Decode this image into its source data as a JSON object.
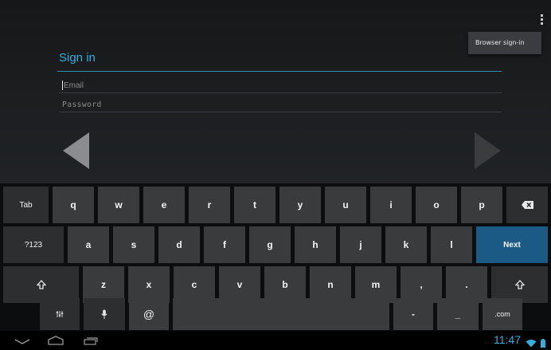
{
  "menu": {
    "overflow_icon": "overflow-menu-icon",
    "popup_item": "Browser sign-in"
  },
  "signin": {
    "title": "Sign in",
    "email_placeholder": "Email",
    "password_placeholder": "Password"
  },
  "pager": {
    "prev_icon": "arrow-left-icon",
    "next_icon": "arrow-right-icon"
  },
  "keyboard": {
    "row1": [
      "q",
      "w",
      "e",
      "r",
      "t",
      "y",
      "u",
      "i",
      "o",
      "p"
    ],
    "row2": [
      "a",
      "s",
      "d",
      "f",
      "g",
      "h",
      "j",
      "k",
      "l"
    ],
    "row3": [
      "z",
      "x",
      "c",
      "v",
      "b",
      "n",
      "m",
      ",",
      "."
    ],
    "row4": [
      "@",
      "-",
      "_"
    ],
    "tab": "Tab",
    "numbers": "?123",
    "next": "Next",
    "dotcom": ".com",
    "icons": {
      "backspace": "backspace-icon",
      "shift": "shift-icon",
      "settings": "settings-icon",
      "mic": "microphone-icon"
    }
  },
  "navbar": {
    "time": "11:47",
    "icons": [
      "back-icon",
      "home-icon",
      "recent-apps-icon",
      "wifi-icon",
      "battery-icon"
    ]
  },
  "colors": {
    "accent": "#33aee0",
    "key": "#393b3d",
    "next_key": "#1c5a86"
  }
}
